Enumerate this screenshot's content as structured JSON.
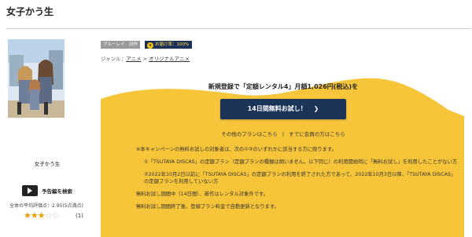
{
  "page": {
    "title": "女子かう生"
  },
  "badges": {
    "bluray": "ブルーレイ",
    "old": "旧作",
    "delivery": "お届け率：100%"
  },
  "genre": {
    "label": "ジャンル：",
    "level1": "アニメ",
    "separator": ">",
    "level2": "オリジナルアニメ"
  },
  "offer": {
    "headline": "新規登録で「定額レンタル4」月額1,026円(税込)を",
    "cta_label": "14日間無料お試し！",
    "other_plans": "その他のプランはこちら",
    "divider": "|",
    "member_link": "すでに会員の方はこちら"
  },
  "notes": [
    "※本キャンペーンの無料お試しの対象者は、次の①②のいずれかに該当する方に限ります。",
    "①「TSUTAYA DISCAS」の定額プラン（定額プランの種類は問いません。以下同じ）の利用開始時に「無料お試し」を利用したことがない方",
    "②2022年10月2日以前に「TSUTAYA DISCAS」の定額プランの利用を終了された方であって、2022年10月3日以降、「TSUTAYA DISCAS」の定額プランを利用していない方",
    "無料お試し期間中（14日間）、新作はレンタル対象外です。",
    "無料お試し期間終了後、登録プラン料金で自動更新となります。"
  ],
  "sidebar": {
    "title": "女子かう生",
    "trailer_label": "予告編を検索",
    "rating_text": "全体の平均評価点：2.95(5点満点)",
    "stars": 3,
    "stars_total": 5,
    "review_count": "(1)"
  },
  "colors": {
    "accent_yellow": "#f7c53a",
    "cta_navy": "#1c3458",
    "star": "#e8a000"
  }
}
